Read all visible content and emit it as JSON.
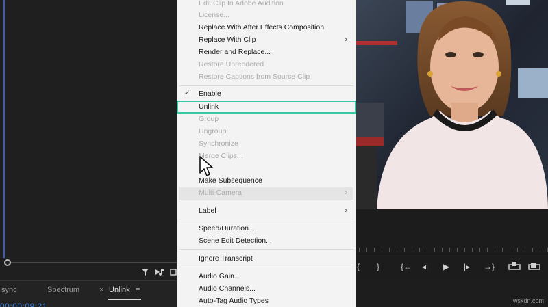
{
  "bottom_panel": {
    "tabs": [
      {
        "label": "sync"
      },
      {
        "label": "Spectrum"
      },
      {
        "label": "Unlink",
        "close": "×",
        "menu": "≡"
      }
    ],
    "timecode": "00:00:09:21"
  },
  "context_menu": {
    "items": [
      {
        "label": "Edit Clip In Adobe Audition",
        "enabled": false
      },
      {
        "label": "License...",
        "enabled": false
      },
      {
        "label": "Replace With After Effects Composition",
        "enabled": true
      },
      {
        "label": "Replace With Clip",
        "enabled": true,
        "submenu": true
      },
      {
        "label": "Render and Replace...",
        "enabled": true
      },
      {
        "label": "Restore Unrendered",
        "enabled": false
      },
      {
        "label": "Restore Captions from Source Clip",
        "enabled": false
      },
      {
        "label": "Enable",
        "enabled": true,
        "checked": true
      },
      {
        "label": "Unlink",
        "enabled": true,
        "highlighted": true
      },
      {
        "label": "Group",
        "enabled": false
      },
      {
        "label": "Ungroup",
        "enabled": false
      },
      {
        "label": "Synchronize",
        "enabled": false
      },
      {
        "label": "Merge Clips...",
        "enabled": false
      },
      {
        "label": "Make Subsequence",
        "enabled": true
      },
      {
        "label": "Multi-Camera",
        "enabled": false,
        "submenu": true
      },
      {
        "label": "Label",
        "enabled": true,
        "submenu": true
      },
      {
        "label": "Speed/Duration...",
        "enabled": true
      },
      {
        "label": "Scene Edit Detection...",
        "enabled": true
      },
      {
        "label": "Ignore Transcript",
        "enabled": true
      },
      {
        "label": "Audio Gain...",
        "enabled": true
      },
      {
        "label": "Audio Channels...",
        "enabled": true
      },
      {
        "label": "Auto-Tag Audio Types",
        "enabled": true
      }
    ],
    "submenu_arrow": "›",
    "check_glyph": "✓",
    "highlight_color": "#3cc7a4"
  },
  "transport": {
    "buttons": [
      "{",
      "}",
      "{←",
      "◂|",
      "▶",
      "|▸",
      "→}"
    ]
  },
  "watermark": "wsxdn.com",
  "colors": {
    "menu_bg": "#f4f3f3",
    "panel_bg": "#1f1f1f",
    "timecode": "#3f7fd8"
  }
}
